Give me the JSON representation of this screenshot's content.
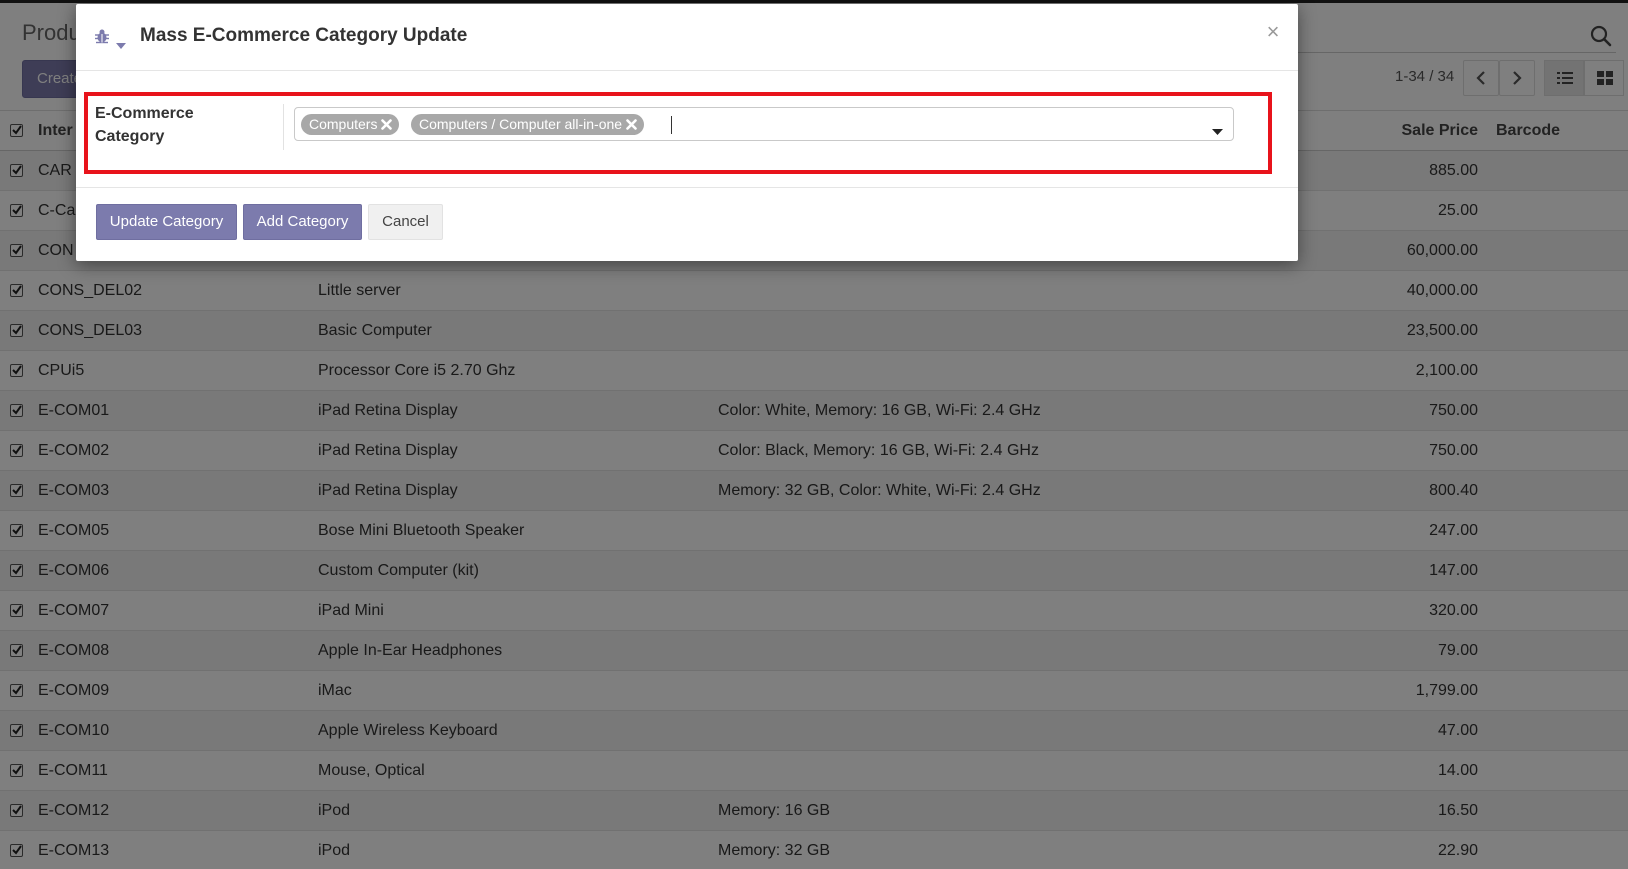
{
  "background": {
    "page_title": "Produ",
    "create_button": "Create",
    "pager": "1-34 / 34",
    "columns": {
      "internal_ref": "Inter",
      "name": "",
      "variants": "",
      "sale_price": "Sale Price",
      "barcode": "Barcode"
    },
    "rows": [
      {
        "ref": "CAR",
        "name": "",
        "variant": "",
        "price": "885.00"
      },
      {
        "ref": "C-Ca",
        "name": "",
        "variant": "",
        "price": "25.00"
      },
      {
        "ref": "CON",
        "name": "",
        "variant": "",
        "price": "60,000.00"
      },
      {
        "ref": "CONS_DEL02",
        "name": "Little server",
        "variant": "",
        "price": "40,000.00"
      },
      {
        "ref": "CONS_DEL03",
        "name": "Basic Computer",
        "variant": "",
        "price": "23,500.00"
      },
      {
        "ref": "CPUi5",
        "name": "Processor Core i5 2.70 Ghz",
        "variant": "",
        "price": "2,100.00"
      },
      {
        "ref": "E-COM01",
        "name": "iPad Retina Display",
        "variant": "Color: White, Memory: 16 GB, Wi-Fi: 2.4 GHz",
        "price": "750.00"
      },
      {
        "ref": "E-COM02",
        "name": "iPad Retina Display",
        "variant": "Color: Black, Memory: 16 GB, Wi-Fi: 2.4 GHz",
        "price": "750.00"
      },
      {
        "ref": "E-COM03",
        "name": "iPad Retina Display",
        "variant": "Memory: 32 GB, Color: White, Wi-Fi: 2.4 GHz",
        "price": "800.40"
      },
      {
        "ref": "E-COM05",
        "name": "Bose Mini Bluetooth Speaker",
        "variant": "",
        "price": "247.00"
      },
      {
        "ref": "E-COM06",
        "name": "Custom Computer (kit)",
        "variant": "",
        "price": "147.00"
      },
      {
        "ref": "E-COM07",
        "name": "iPad Mini",
        "variant": "",
        "price": "320.00"
      },
      {
        "ref": "E-COM08",
        "name": "Apple In-Ear Headphones",
        "variant": "",
        "price": "79.00"
      },
      {
        "ref": "E-COM09",
        "name": "iMac",
        "variant": "",
        "price": "1,799.00"
      },
      {
        "ref": "E-COM10",
        "name": "Apple Wireless Keyboard",
        "variant": "",
        "price": "47.00"
      },
      {
        "ref": "E-COM11",
        "name": "Mouse, Optical",
        "variant": "",
        "price": "14.00"
      },
      {
        "ref": "E-COM12",
        "name": "iPod",
        "variant": "Memory: 16 GB",
        "price": "16.50"
      },
      {
        "ref": "E-COM13",
        "name": "iPod",
        "variant": "Memory: 32 GB",
        "price": "22.90"
      }
    ]
  },
  "modal": {
    "title": "Mass E-Commerce Category Update",
    "close_symbol": "×",
    "debug_icon": "bug-icon",
    "field_label": "E-Commerce Category",
    "tags": [
      {
        "label": "Computers"
      },
      {
        "label": "Computers / Computer all-in-one"
      }
    ],
    "buttons": {
      "update": "Update Category",
      "add": "Add Category",
      "cancel": "Cancel"
    }
  },
  "colors": {
    "primary": "#7c7bad",
    "highlight": "#e8131b",
    "tag": "#a8a8a8"
  }
}
